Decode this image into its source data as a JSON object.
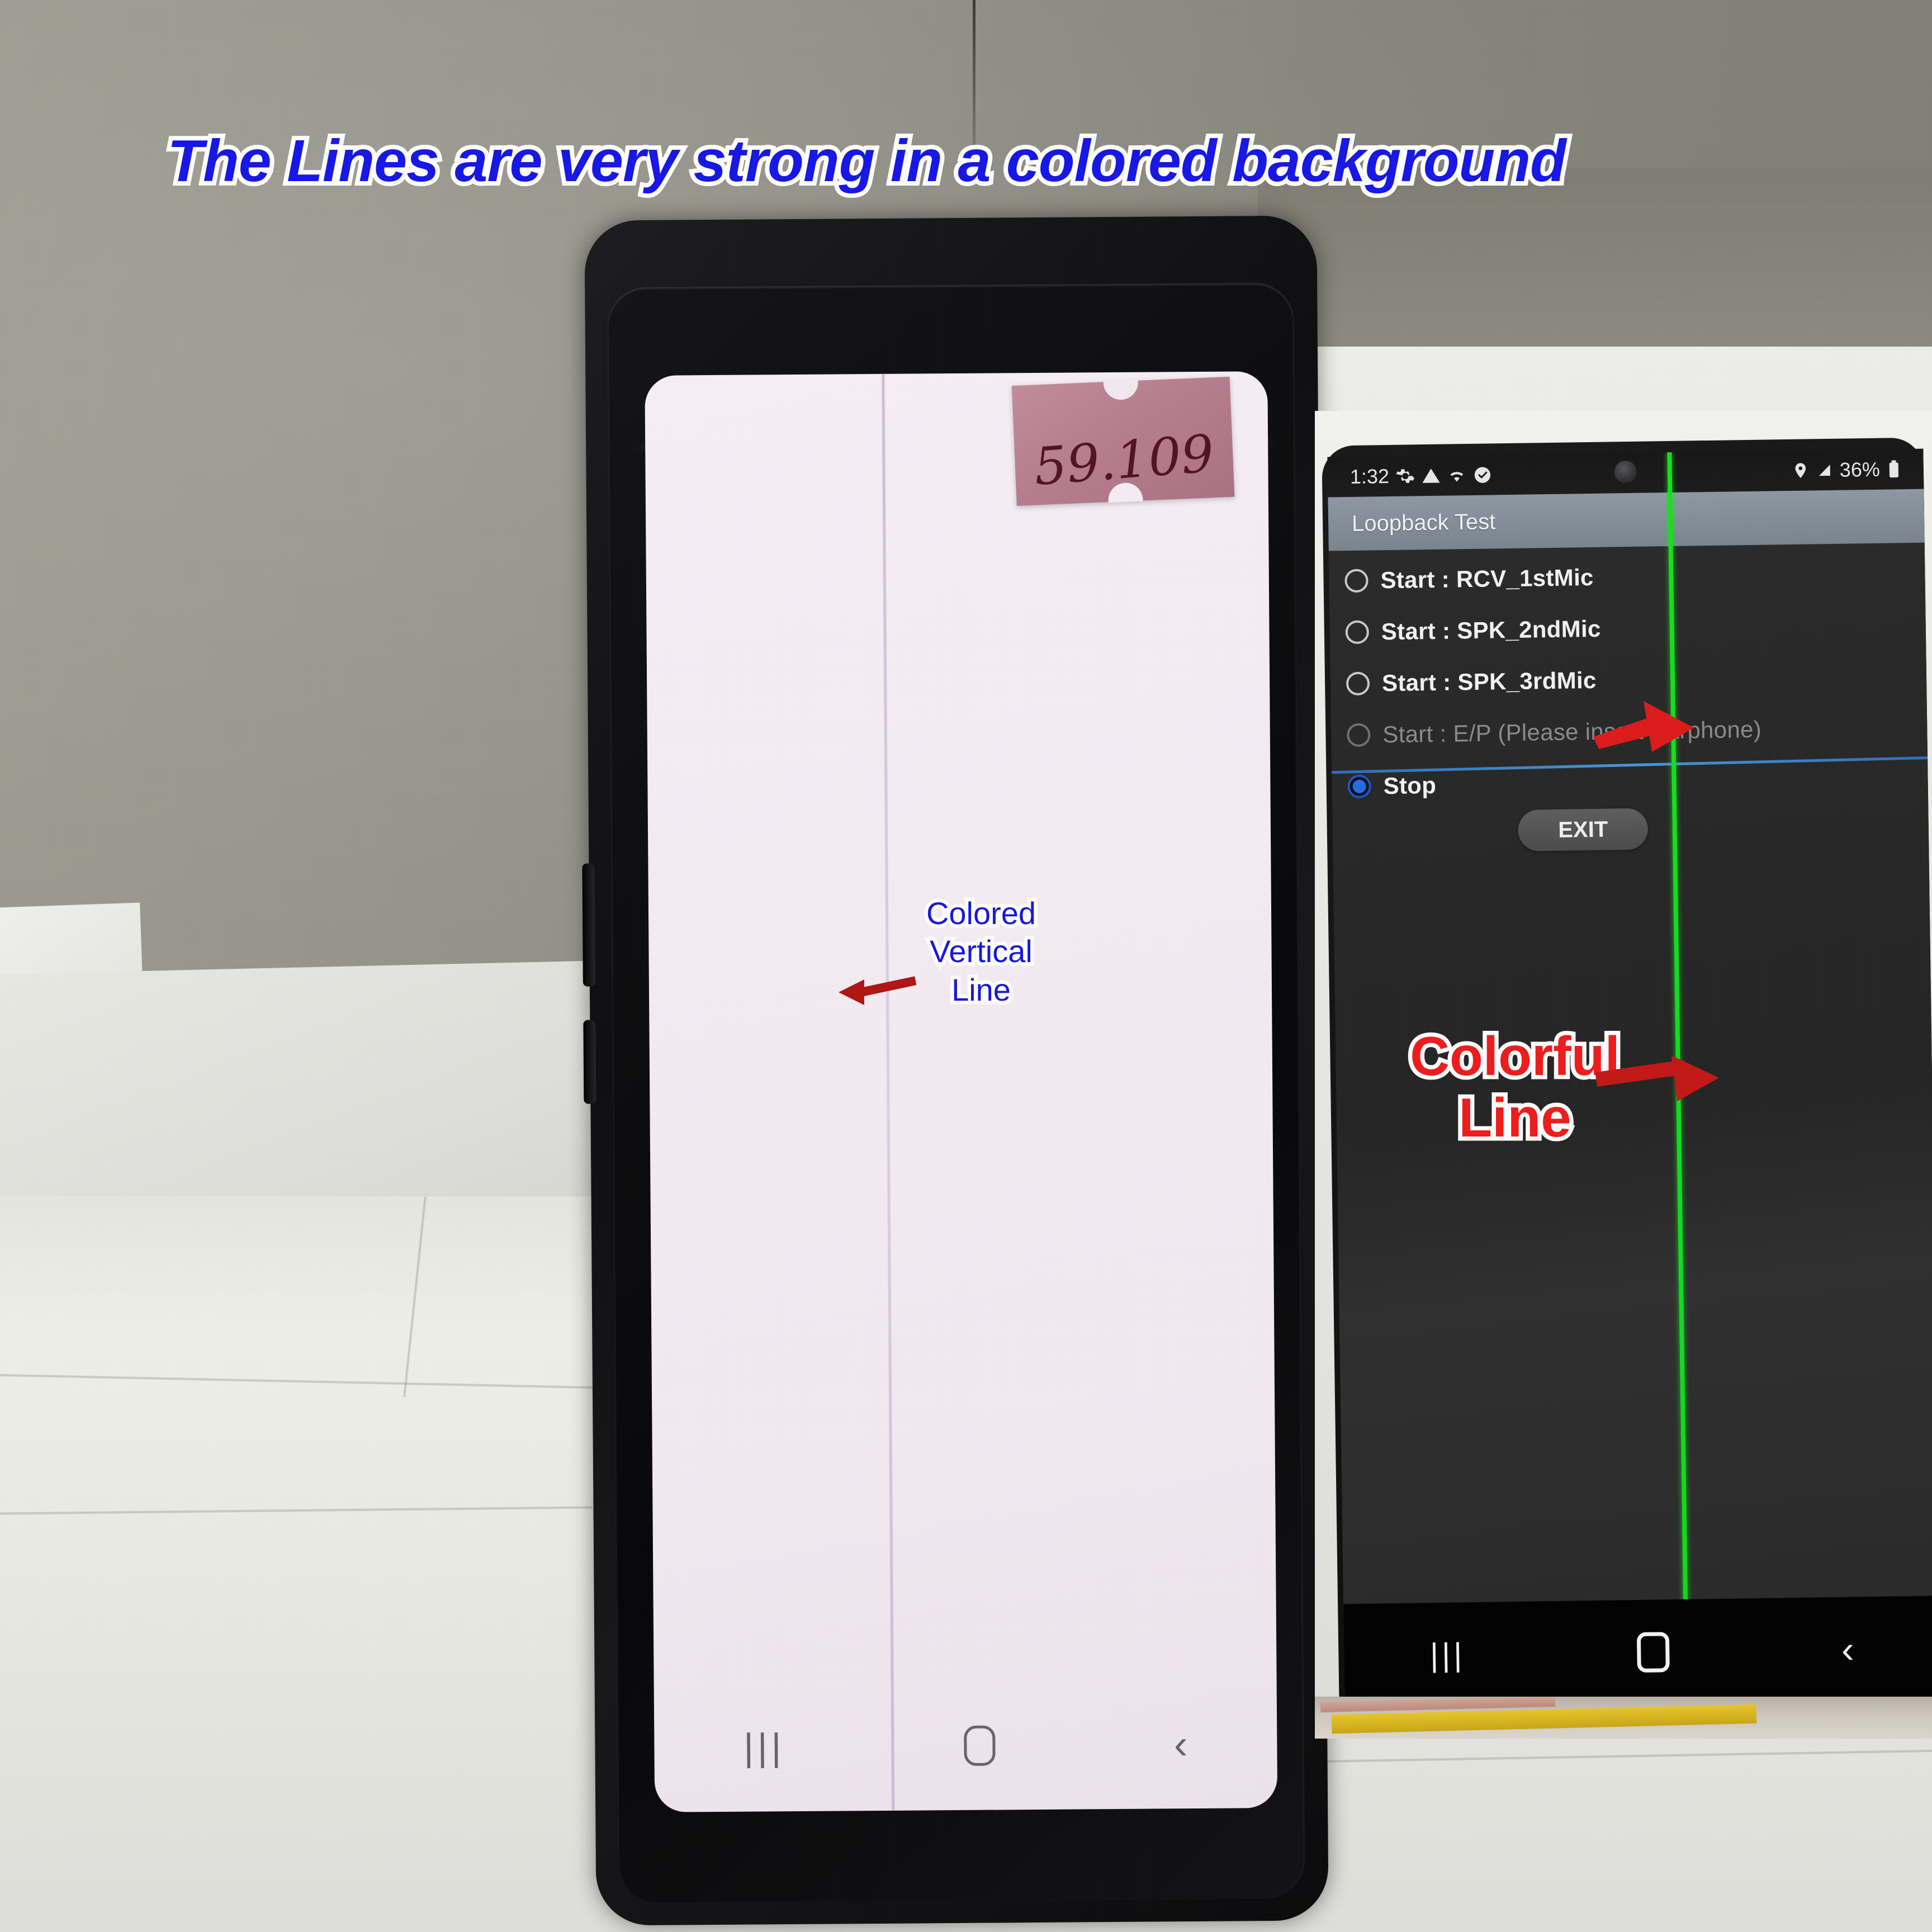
{
  "annotations": {
    "title": "The Lines are very strong in a colored background",
    "title_color": "#1515dd",
    "title_outline_color": "#ffffff",
    "left_label": "Colored Vertical Line",
    "left_label_lines": [
      "Colored",
      "Vertical",
      "Line"
    ],
    "left_label_color": "#1515dd",
    "right_label_lines": [
      "Colorful",
      "Line"
    ],
    "right_label_color": "#f01a1a",
    "arrow_color_left": "#b01414",
    "arrow_color_right": "#dd1a1a"
  },
  "left_phone": {
    "screen_color": "#f4ecf3",
    "defect_line_color": "#cdb9d7",
    "sticker": {
      "value": "59.109",
      "background_color": "#b97f90",
      "ink_color": "#4e1320"
    },
    "navbar": {
      "recents_icon": "|||",
      "home_icon": "home-rounded-square",
      "back_icon": "‹"
    }
  },
  "right_phone": {
    "status_bar": {
      "time": "1:32",
      "left_icons": [
        "gear-icon",
        "warning-triangle-icon",
        "wifi-icon",
        "check-circle-icon"
      ],
      "right_icons": [
        "location-pin-icon",
        "signal-icon"
      ],
      "battery": "36%",
      "battery_icon": "battery-icon"
    },
    "app": {
      "title": "Loopback Test",
      "title_bar_color": "#7e8a95",
      "options": [
        {
          "label": "Start : RCV_1stMic",
          "state": "off",
          "enabled": true
        },
        {
          "label": "Start : SPK_2ndMic",
          "state": "off",
          "enabled": true
        },
        {
          "label": "Start : SPK_3rdMic",
          "state": "off",
          "enabled": true
        },
        {
          "label": "Start : E/P (Please insert Earphone)",
          "state": "off",
          "enabled": false
        },
        {
          "label": "Stop",
          "state": "on",
          "enabled": true
        }
      ],
      "exit_button": "EXIT"
    },
    "defect": {
      "green_line_color": "#16dd1d",
      "blue_line_color": "#3a86d6"
    },
    "navbar": {
      "recents_icon": "|||",
      "home_icon": "home-rounded-square",
      "back_icon": "‹"
    }
  }
}
